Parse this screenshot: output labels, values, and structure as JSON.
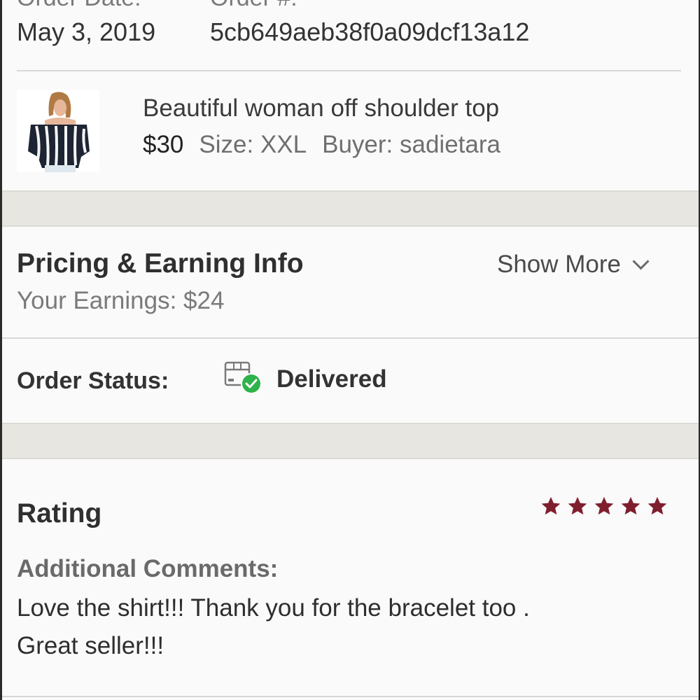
{
  "order": {
    "date_label": "Order Date:",
    "number_label": "Order #:",
    "date_value": "May 3, 2019",
    "number_value": "5cb649aeb38f0a09dcf13a12"
  },
  "item": {
    "title": "Beautiful woman off shoulder top",
    "price": "$30",
    "size": "Size: XXL",
    "buyer": "Buyer: sadietara",
    "thumbnail_icon": "product-photo-striped-top"
  },
  "pricing": {
    "title": "Pricing & Earning Info",
    "show_more_label": "Show More",
    "earnings": "Your Earnings: $24"
  },
  "status": {
    "label": "Order Status:",
    "value": "Delivered",
    "icon": "delivered-package-check-icon",
    "check_color": "#2db34a"
  },
  "rating": {
    "title": "Rating",
    "stars": 5,
    "max_stars": 5,
    "star_color": "#7f1f2e",
    "comments_label": "Additional Comments:",
    "comments": "Love the shirt!!! Thank you for the bracelet too .\nGreat seller!!!"
  }
}
